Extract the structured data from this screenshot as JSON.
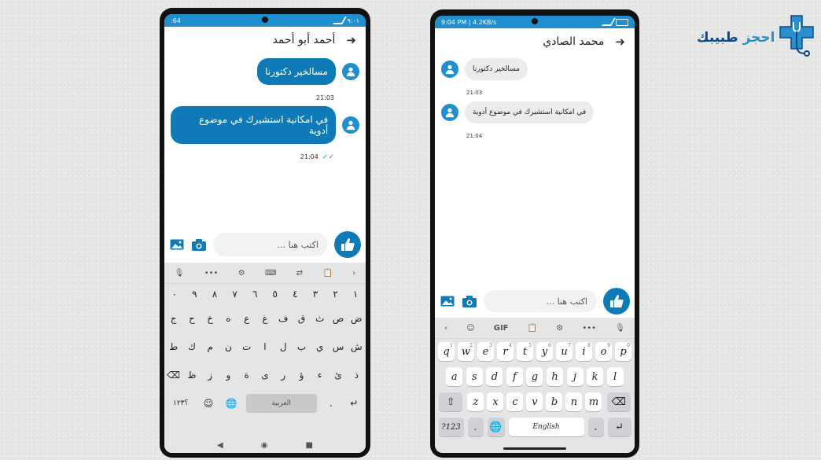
{
  "logo": {
    "word1": "احجز",
    "word2": "طبيبك",
    "color1": "#2a8fce",
    "color2": "#0b4a8c",
    "icon": "medical-cross-stethoscope-icon"
  },
  "colors": {
    "accent": "#1f8fd0",
    "bubble": "#0e7bb8"
  },
  "left_phone": {
    "status_left": ":64",
    "status_right": "٩:٠١",
    "contact_name": "أحمد أبو أحمد",
    "messages": [
      {
        "text": "مسالخير دكتورنا",
        "time": "21:03"
      },
      {
        "text": "في امكانية استشيرك في موضوع أدوية",
        "time": "21:04"
      }
    ],
    "input_placeholder": "اكتب هنا ...",
    "keyboard": {
      "digits": [
        "٠",
        "٩",
        "٨",
        "٧",
        "٦",
        "٥",
        "٤",
        "٣",
        "٢",
        "١"
      ],
      "row1": [
        "ج",
        "ح",
        "خ",
        "ه",
        "ع",
        "غ",
        "ف",
        "ق",
        "ث",
        "ص",
        "ض"
      ],
      "row2": [
        "ط",
        "ك",
        "م",
        "ن",
        "ت",
        "ا",
        "ل",
        "ب",
        "ي",
        "س",
        "ش"
      ],
      "row3": [
        "ظ",
        "ز",
        "و",
        "ة",
        "ى",
        "ر",
        "ؤ",
        "ء",
        "ئ",
        "ذ"
      ],
      "num_key": "؟١٢٣",
      "space_label": "العربية",
      "punct": "."
    }
  },
  "right_phone": {
    "status_left": "9:04 PM | 4.2KB/s",
    "contact_name": "محمد الصادي",
    "messages": [
      {
        "text": "مسالخير دكتورنا",
        "time": "21:03"
      },
      {
        "text": "في امكانية استشيرك في موضوع أدوية",
        "time": "21:04"
      }
    ],
    "input_placeholder": "اكتب هنا ...",
    "keyboard": {
      "toolbar_gif": "GIF",
      "row1": [
        [
          "q",
          "1"
        ],
        [
          "w",
          "2"
        ],
        [
          "e",
          "3"
        ],
        [
          "r",
          "4"
        ],
        [
          "t",
          "5"
        ],
        [
          "y",
          "6"
        ],
        [
          "u",
          "7"
        ],
        [
          "i",
          "8"
        ],
        [
          "o",
          "9"
        ],
        [
          "p",
          "0"
        ]
      ],
      "row2": [
        "a",
        "s",
        "d",
        "f",
        "g",
        "h",
        "j",
        "k",
        "l"
      ],
      "row3": [
        "z",
        "x",
        "c",
        "v",
        "b",
        "n",
        "m"
      ],
      "num_key": "?123",
      "comma": ",",
      "space_label": "English",
      "period": "."
    }
  }
}
